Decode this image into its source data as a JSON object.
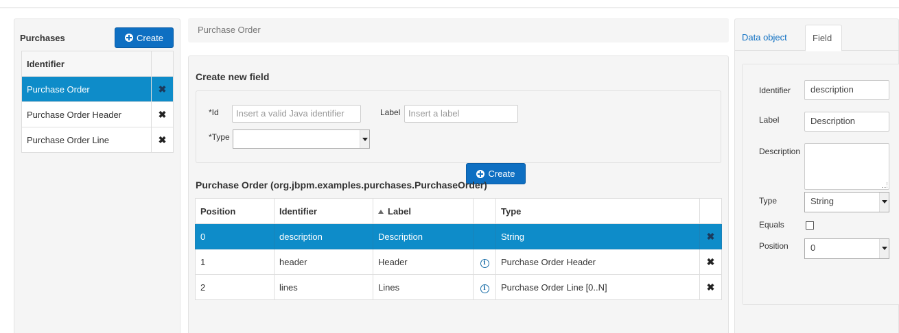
{
  "left": {
    "title": "Purchases",
    "create_label": "Create",
    "table_header": "Identifier",
    "objects": [
      {
        "label": "Purchase Order",
        "selected": true
      },
      {
        "label": "Purchase Order Header",
        "selected": false
      },
      {
        "label": "Purchase Order Line",
        "selected": false
      }
    ]
  },
  "breadcrumb": "Purchase Order",
  "form": {
    "heading": "Create new field",
    "id_label": "*Id",
    "id_placeholder": "Insert a valid Java identifier",
    "label_label": "Label",
    "label_placeholder": "Insert a label",
    "type_label": "*Type",
    "type_value": "",
    "create_label": "Create"
  },
  "fields_table": {
    "title": "Purchase Order (org.jbpm.examples.purchases.PurchaseOrder)",
    "headers": [
      "Position",
      "Identifier",
      "Label",
      "",
      "Type"
    ],
    "sort_column": "Label",
    "rows": [
      {
        "position": "0",
        "identifier": "description",
        "label": "Description",
        "info": false,
        "type": "String",
        "selected": true
      },
      {
        "position": "1",
        "identifier": "header",
        "label": "Header",
        "info": true,
        "type": "Purchase Order Header",
        "selected": false
      },
      {
        "position": "2",
        "identifier": "lines",
        "label": "Lines",
        "info": true,
        "type": "Purchase Order Line [0..N]",
        "selected": false
      }
    ]
  },
  "right": {
    "tabs": [
      "Data object",
      "Field"
    ],
    "active_tab": "Field",
    "identifier_label": "Identifier",
    "identifier_value": "description",
    "label_label": "Label",
    "label_value": "Description",
    "description_label": "Description",
    "description_value": "",
    "type_label": "Type",
    "type_value": "String",
    "equals_label": "Equals",
    "equals_checked": false,
    "position_label": "Position",
    "position_value": "0"
  },
  "colors": {
    "primary": "#0e6fc2",
    "selected_row": "#0e8cc9"
  }
}
